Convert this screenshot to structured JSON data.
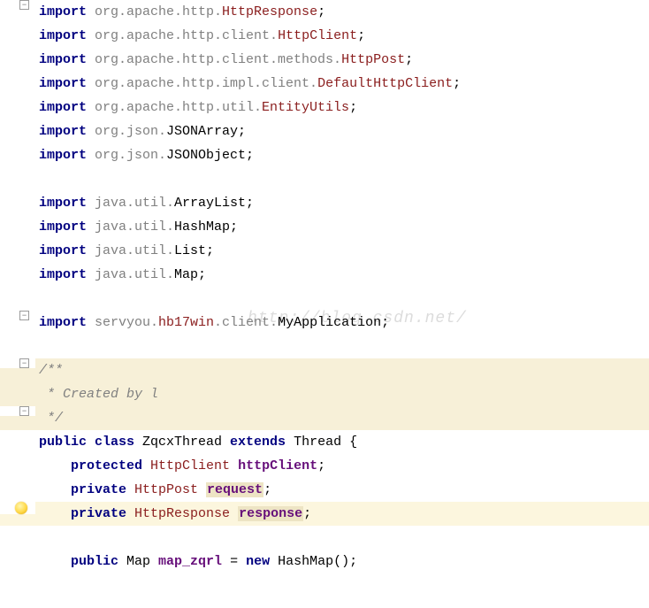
{
  "watermark": "http://blog.csdn.net/",
  "lines": {
    "l1": {
      "imp": "import ",
      "pkg": "org.apache.http.",
      "cls": "HttpResponse",
      "sc": ";"
    },
    "l2": {
      "imp": "import ",
      "pkg": "org.apache.http.client.",
      "cls": "HttpClient",
      "sc": ";"
    },
    "l3": {
      "imp": "import ",
      "pkg": "org.apache.http.client.methods.",
      "cls": "HttpPost",
      "sc": ";"
    },
    "l4": {
      "imp": "import ",
      "pkg": "org.apache.http.impl.client.",
      "cls": "DefaultHttpClient",
      "sc": ";"
    },
    "l5": {
      "imp": "import ",
      "pkg": "org.apache.http.util.",
      "cls": "EntityUtils",
      "sc": ";"
    },
    "l6": {
      "imp": "import ",
      "pkg": "org.json.",
      "cls": "JSONArray",
      "sc": ";"
    },
    "l7": {
      "imp": "import ",
      "pkg": "org.json.",
      "cls": "JSONObject",
      "sc": ";"
    },
    "l8": {
      "imp": "import ",
      "pkg": "java.util.",
      "cls": "ArrayList",
      "sc": ";"
    },
    "l9": {
      "imp": "import ",
      "pkg": "java.util.",
      "cls": "HashMap",
      "sc": ";"
    },
    "l10": {
      "imp": "import ",
      "pkg": "java.util.",
      "cls": "List",
      "sc": ";"
    },
    "l11": {
      "imp": "import ",
      "pkg": "java.util.",
      "cls": "Map",
      "sc": ";"
    },
    "l12": {
      "imp": "import ",
      "pkg": "servyou.",
      "cls1": "hb17win",
      "pkg2": ".client.",
      "cls2": "MyApplication",
      "sc": ";"
    },
    "c1": "/**",
    "c2": " * Created by l",
    "c3": " */",
    "d1": {
      "pub": "public class ",
      "name": "ZqcxThread",
      "ext": " extends ",
      "sup": "Thread",
      "br": " {"
    },
    "d2": {
      "mod": "protected ",
      "type": "HttpClient ",
      "name": "httpClient",
      "sc": ";"
    },
    "d3": {
      "mod": "private ",
      "type": "HttpPost ",
      "name": "request",
      "sc": ";"
    },
    "d4": {
      "mod": "private ",
      "type": "HttpResponse ",
      "name": "response",
      "sc": ";"
    },
    "d5": {
      "mod": "public ",
      "type": "Map ",
      "name": "map_zqrl",
      "eq": " = ",
      "new": "new ",
      "ctor": "HashMap",
      "par": "()",
      "sc": ";"
    }
  },
  "fold": {
    "minus": "−",
    "plus": "+"
  }
}
